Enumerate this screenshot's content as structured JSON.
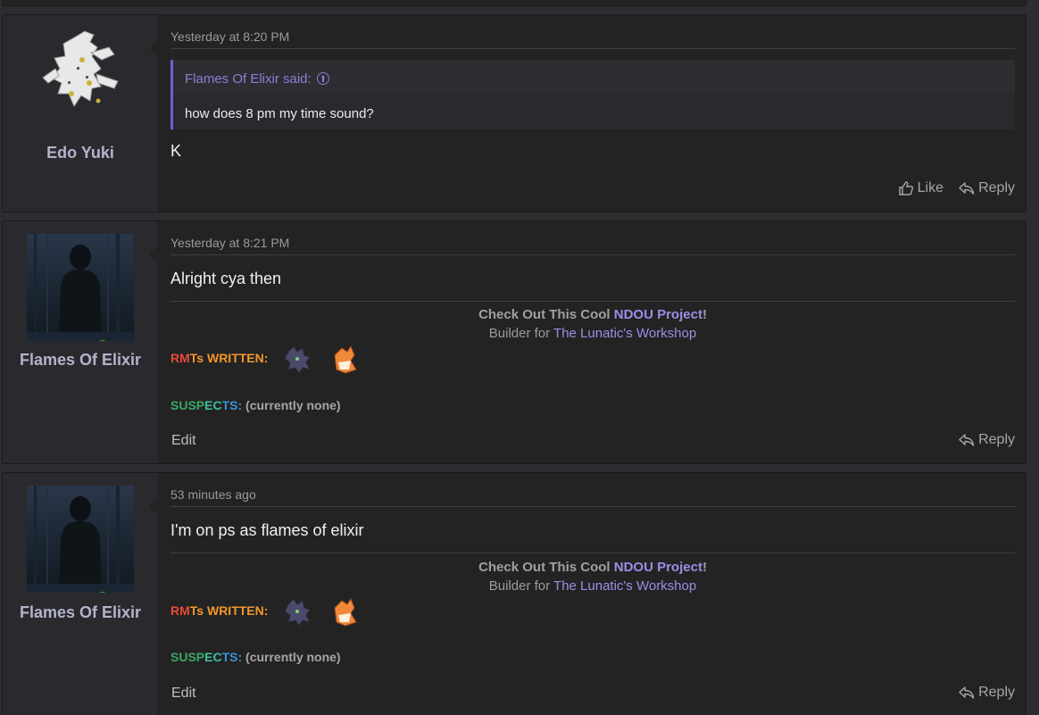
{
  "posts": [
    {
      "username": "Edo Yuki",
      "date": "Yesterday at 8:20 PM",
      "quote": {
        "author_said": "Flames Of Elixir said:",
        "text": "how does 8 pm my time sound?"
      },
      "message": "K",
      "actions": {
        "like": "Like",
        "reply": "Reply"
      }
    },
    {
      "username": "Flames Of Elixir",
      "date": "Yesterday at 8:21 PM",
      "message": "Alright cya then",
      "actions": {
        "edit": "Edit",
        "reply": "Reply"
      }
    },
    {
      "username": "Flames Of Elixir",
      "date": "53 minutes ago",
      "message": "I'm on ps as flames of elixir",
      "actions": {
        "edit": "Edit",
        "reply": "Reply"
      }
    }
  ],
  "signature": {
    "line1_prefix": "Check Out This Cool",
    "line1_link": "NDOU Project",
    "line1_suffix": "!",
    "line2_prefix": "Builder for",
    "line2_link": "The Lunatic's Workshop",
    "rmts_rm": "RM",
    "rmts_ts": "Ts",
    "rmts_written": "WRITTEN:",
    "suspects_a": "SUSP",
    "suspects_b": "EC",
    "suspects_c": "TS:",
    "suspects_value": "(currently none)"
  },
  "icons": {
    "quote_jump": "arrow-up-circle-icon",
    "like": "thumbs-up-icon",
    "reply": "reply-arrow-icon",
    "online": "online-status-icon"
  },
  "colors": {
    "background": "#2d2d31",
    "post": "#232323",
    "user_column": "#2a2a2e",
    "link": "#9a8fe6",
    "quote_bar": "#6f5fcf"
  }
}
